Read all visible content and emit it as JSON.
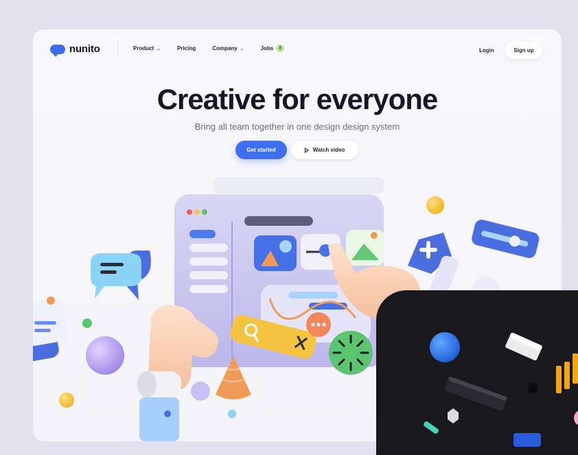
{
  "brand": {
    "name": "nunito",
    "accent": "#3c6cf3"
  },
  "nav": {
    "items": [
      {
        "label": "Product",
        "has_dropdown": true
      },
      {
        "label": "Pricing",
        "has_dropdown": false
      },
      {
        "label": "Company",
        "has_dropdown": true
      },
      {
        "label": "Jobs",
        "badge": "8"
      }
    ]
  },
  "auth": {
    "login_label": "Login",
    "signup_label": "Sign up"
  },
  "hero": {
    "title": "Creative for everyone",
    "subtitle": "Bring all team together in one design design system",
    "primary_cta": "Get started",
    "secondary_cta": "Watch video"
  },
  "icons": {
    "logo": "chat-bubble-logo-icon",
    "play": "play-icon",
    "dropdown": "chevron-down-icon"
  }
}
